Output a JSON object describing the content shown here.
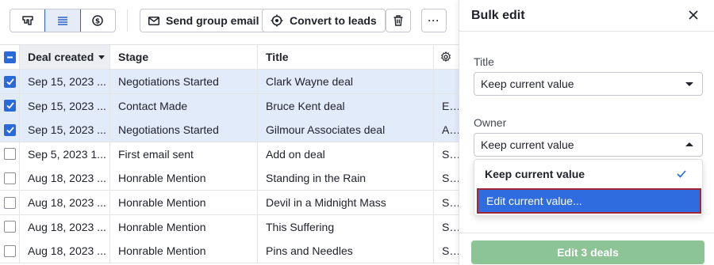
{
  "toolbar": {
    "view_icons": [
      "pipeline-icon",
      "list-icon",
      "forecast-icon"
    ],
    "send_email_label": "Send group email",
    "convert_label": "Convert to leads",
    "delete_icon": "trash-icon",
    "more_label": "···"
  },
  "table": {
    "headers": {
      "deal_created": "Deal created",
      "stage": "Stage",
      "title": "Title"
    },
    "rows": [
      {
        "selected": true,
        "date": "Sep 15, 2023 ...",
        "stage": "Negotiations Started",
        "title": "Clark Wayne deal",
        "owner": ""
      },
      {
        "selected": true,
        "date": "Sep 15, 2023 ...",
        "stage": "Contact Made",
        "title": "Bruce Kent deal",
        "owner": "Edw"
      },
      {
        "selected": true,
        "date": "Sep 15, 2023 ...",
        "stage": "Negotiations Started",
        "title": "Gilmour Associates deal",
        "owner": "Aria"
      },
      {
        "selected": false,
        "date": "Sep 5, 2023 1...",
        "stage": "First email sent",
        "title": "Add on deal",
        "owner": "Stev"
      },
      {
        "selected": false,
        "date": "Aug 18, 2023 ...",
        "stage": "Honrable Mention",
        "title": "Standing in the Rain",
        "owner": "Stev"
      },
      {
        "selected": false,
        "date": "Aug 18, 2023 ...",
        "stage": "Honrable Mention",
        "title": "Devil in a Midnight Mass",
        "owner": "Stev"
      },
      {
        "selected": false,
        "date": "Aug 18, 2023 ...",
        "stage": "Honrable Mention",
        "title": "This Suffering",
        "owner": "Stev"
      },
      {
        "selected": false,
        "date": "Aug 18, 2023 ...",
        "stage": "Honrable Mention",
        "title": "Pins and Needles",
        "owner": "Stev"
      }
    ]
  },
  "bulk_edit": {
    "title": "Bulk edit",
    "title_field": {
      "label": "Title",
      "value": "Keep current value"
    },
    "owner_field": {
      "label": "Owner",
      "value": "Keep current value"
    },
    "dropdown_options": [
      "Keep current value",
      "Edit current value..."
    ],
    "submit_label": "Edit 3 deals"
  },
  "colors": {
    "accent": "#2a6ad8",
    "selected_row": "#e1ebfa",
    "submit_disabled": "#8cc495",
    "highlight_option": "#2f6ce0"
  }
}
